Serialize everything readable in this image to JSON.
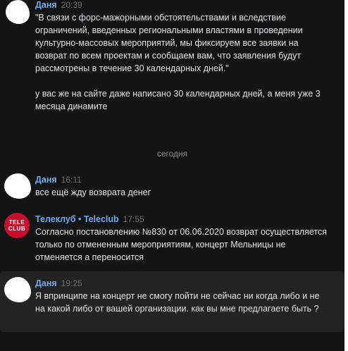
{
  "messages": [
    {
      "author": "Даня",
      "time": "20:39",
      "text": "\"В связи с форс-мажорными обстоятельствами и вследствие ограничений, введенных региональными властями в проведении культурно-массовых мероприятий, мы фиксируем все заявки на возврат по всем проектам и сообщаем вам, что заявления будут рассмотрены в течение 30 календарных дней.\"\n\nу вас же на сайте даже написано 30 календарных дней, а меня уже 3 месяца динамите"
    },
    {
      "author": "Даня",
      "time": "16:11",
      "text": "все ещё жду возврата денег"
    },
    {
      "author": "Телеклуб • Teleclub",
      "time": "17:55",
      "text": "Согласно постановлению №830 от 06.06.2020 возврат осуществляется только по отмененным мероприятиям, концерт Мельницы не отменяется а переносится"
    },
    {
      "author": "Даня",
      "time": "19:25",
      "text": "Я впринципе на концерт не смогу пойти не сейчас ни когда либо и не на какой либо от вашей организации. как вы мне предлагаете быть ?"
    }
  ],
  "date_divider": "сегодня",
  "colors": {
    "background": "#141414",
    "author": "#71aaeb",
    "text": "#e1e3e6",
    "highlight": "#232323",
    "brand": "#c8102e"
  }
}
